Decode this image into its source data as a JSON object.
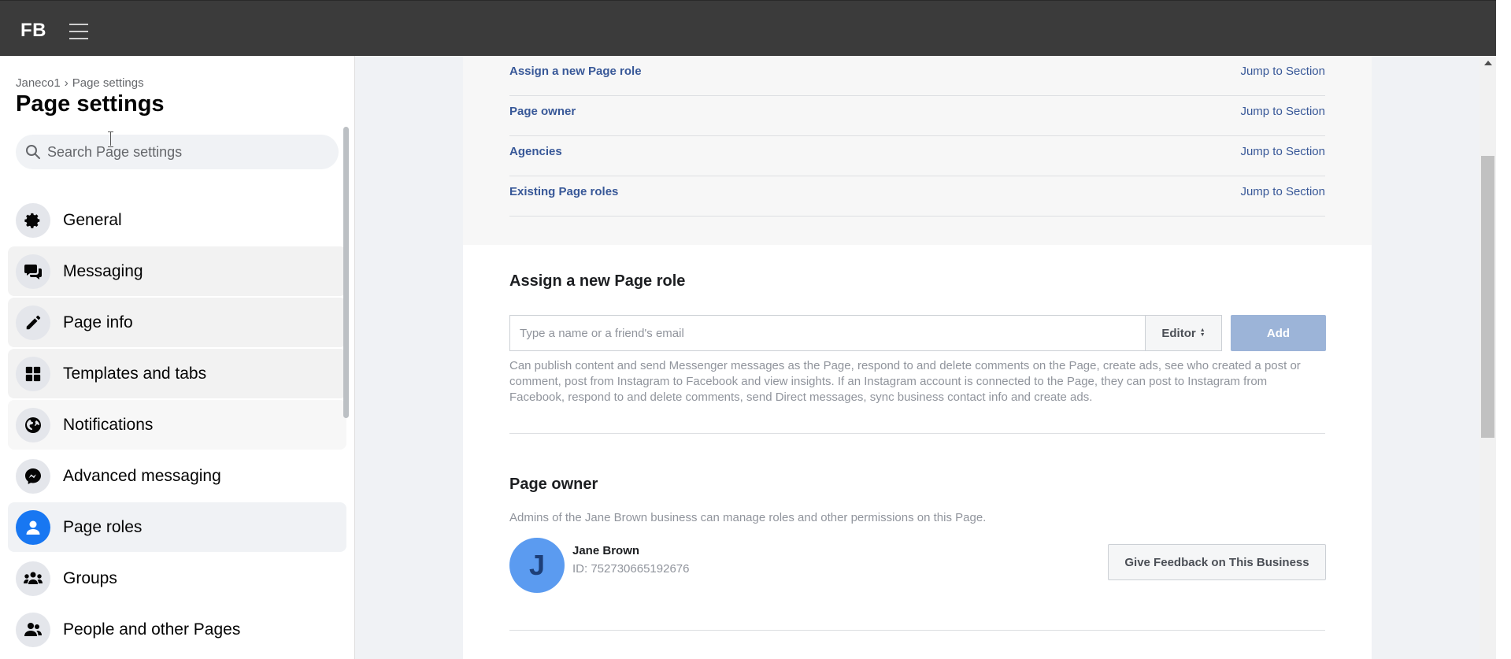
{
  "topbar": {
    "logo": "FB"
  },
  "sidebar": {
    "breadcrumb": {
      "parent": "Janeco1",
      "separator": "›",
      "current": "Page settings"
    },
    "title": "Page settings",
    "search": {
      "placeholder": "Search Page settings",
      "value": ""
    },
    "items": [
      {
        "label": "General",
        "icon": "gear-icon"
      },
      {
        "label": "Messaging",
        "icon": "chat-bubbles-icon"
      },
      {
        "label": "Page info",
        "icon": "pencil-icon"
      },
      {
        "label": "Templates and tabs",
        "icon": "grid-icon"
      },
      {
        "label": "Notifications",
        "icon": "globe-icon"
      },
      {
        "label": "Advanced messaging",
        "icon": "messenger-icon"
      },
      {
        "label": "Page roles",
        "icon": "person-icon",
        "active": true
      },
      {
        "label": "Groups",
        "icon": "groups-icon"
      },
      {
        "label": "People and other Pages",
        "icon": "people-icon"
      }
    ]
  },
  "toc": [
    {
      "label": "Assign a new Page role",
      "jump": "Jump to Section"
    },
    {
      "label": "Page owner",
      "jump": "Jump to Section"
    },
    {
      "label": "Agencies",
      "jump": "Jump to Section"
    },
    {
      "label": "Existing Page roles",
      "jump": "Jump to Section"
    }
  ],
  "assign": {
    "title": "Assign a new Page role",
    "placeholder": "Type a name or a friend's email",
    "role": "Editor",
    "add_label": "Add",
    "description": "Can publish content and send Messenger messages as the Page, respond to and delete comments on the Page, create ads, see who created a post or comment, post from Instagram to Facebook and view insights. If an Instagram account is connected to the Page, they can post to Instagram from Facebook, respond to and delete comments, send Direct messages, sync business contact info and create ads."
  },
  "owner": {
    "title": "Page owner",
    "description": "Admins of the Jane Brown business can manage roles and other permissions on this Page.",
    "avatar_letter": "J",
    "name": "Jane Brown",
    "id": "ID: 752730665192676",
    "feedback_label": "Give Feedback on This Business"
  },
  "colors": {
    "accent": "#1877f2",
    "link": "#385898",
    "add_button": "#9cb4d8",
    "topbar": "#3b3b3b"
  }
}
